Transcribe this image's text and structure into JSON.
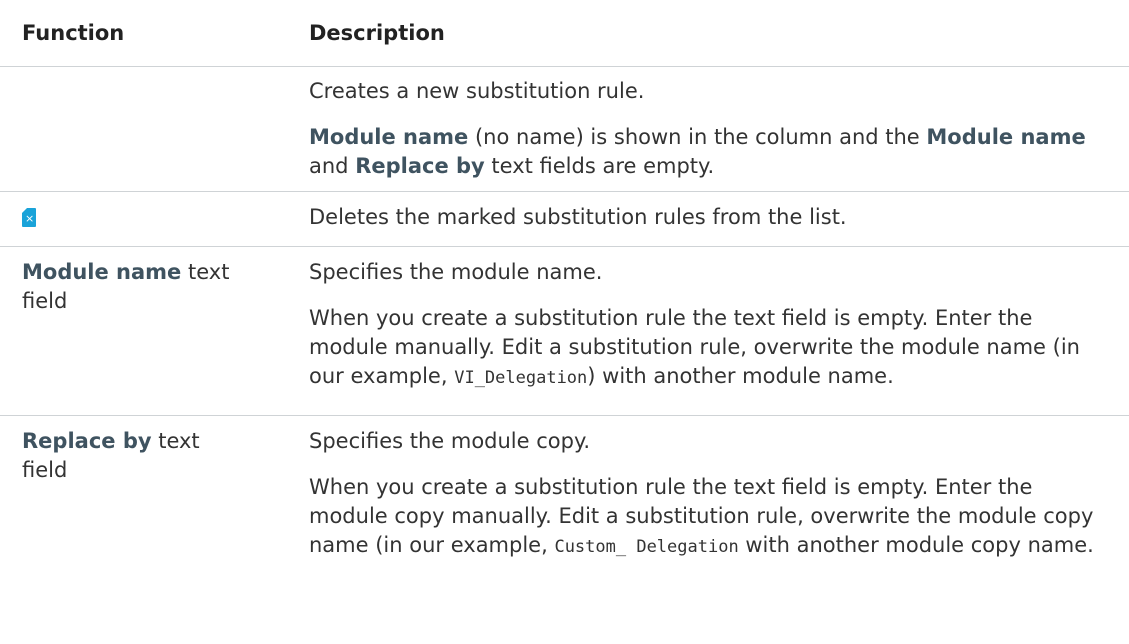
{
  "table": {
    "headers": {
      "function": "Function",
      "description": "Description"
    },
    "rows": [
      {
        "function": "",
        "description": [
          "Creates a new substitution rule.",
          {
            "term1": "Module name",
            "text1": " (no name) is shown in the column and the ",
            "term2": "Module name",
            "text2": " and ",
            "term3": "Replace by",
            "text3": " text fields are empty."
          }
        ]
      },
      {
        "function_icon": "delete-file-icon",
        "description": [
          "Deletes the marked substitution rules from the list."
        ]
      },
      {
        "function_term": "Module name",
        "function_suffix": " text",
        "function_line2": "field",
        "description": [
          "Specifies the module name.",
          {
            "text1": "When you create a substitution rule the text field is empty. Enter the module manually. Edit a substitution rule, overwrite the module name (in our example, ",
            "code": "VI_Delegation",
            "text2": ") with another module name."
          }
        ]
      },
      {
        "function_term": "Replace by",
        "function_suffix": " text",
        "function_line2": "field",
        "description": [
          "Specifies the module copy.",
          {
            "text1": "When you create a substitution rule the text field is empty. Enter the module copy manually. Edit a substitution rule, overwrite the module copy name (in our example, ",
            "code": "Custom_ Delegation",
            "text2": " with another module copy name."
          }
        ]
      }
    ]
  },
  "colors": {
    "term": "#3f5360",
    "icon": "#1aa3d9",
    "divider": "#cfd3d6"
  }
}
